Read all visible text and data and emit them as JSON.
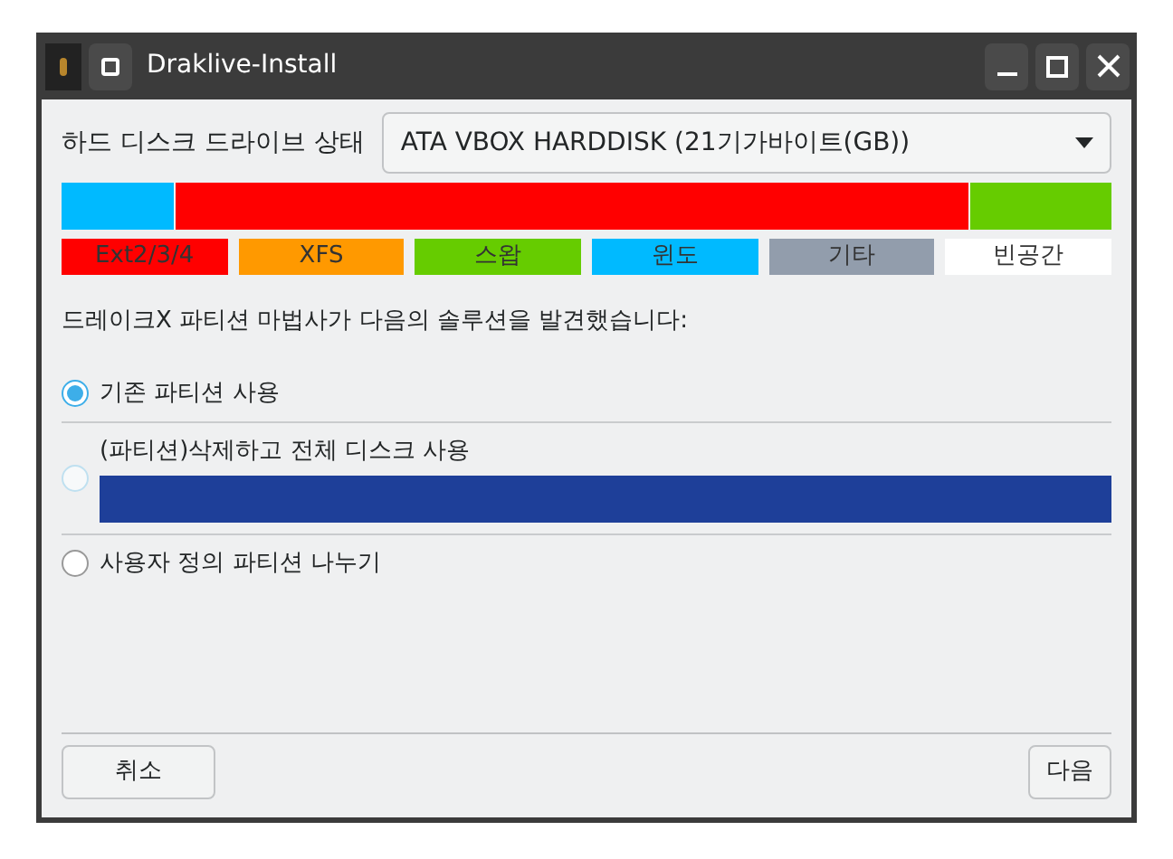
{
  "window": {
    "title": "Draklive-Install"
  },
  "disk": {
    "label": "하드 디스크 드라이브 상태",
    "selected_drive": "ATA VBOX HARDDISK (21기가바이트(GB))"
  },
  "partitions": [
    {
      "color": "#00baff"
    },
    {
      "color": "#ff0000"
    },
    {
      "color": "#66cc00"
    }
  ],
  "legend": [
    {
      "label": "Ext2/3/4",
      "color": "#ff0000"
    },
    {
      "label": "XFS",
      "color": "#ff9900"
    },
    {
      "label": "스왑",
      "color": "#66cc00"
    },
    {
      "label": "윈도",
      "color": "#00baff"
    },
    {
      "label": "기타",
      "color": "#929dac"
    },
    {
      "label": "빈공간",
      "color": "#ffffff"
    }
  ],
  "message": "드레이크X 파티션 마법사가 다음의 솔루션을 발견했습니다:",
  "options": [
    {
      "label": "기존 파티션 사용",
      "selected": true,
      "disabled": false
    },
    {
      "label": "(파티션)삭제하고 전체 디스크 사용",
      "selected": false,
      "disabled": true,
      "partitions": [
        {
          "color": "#1e3f99"
        }
      ]
    },
    {
      "label": "사용자 정의 파티션 나누기",
      "selected": false,
      "disabled": false
    }
  ],
  "buttons": {
    "cancel": "취소",
    "next": "다음"
  }
}
